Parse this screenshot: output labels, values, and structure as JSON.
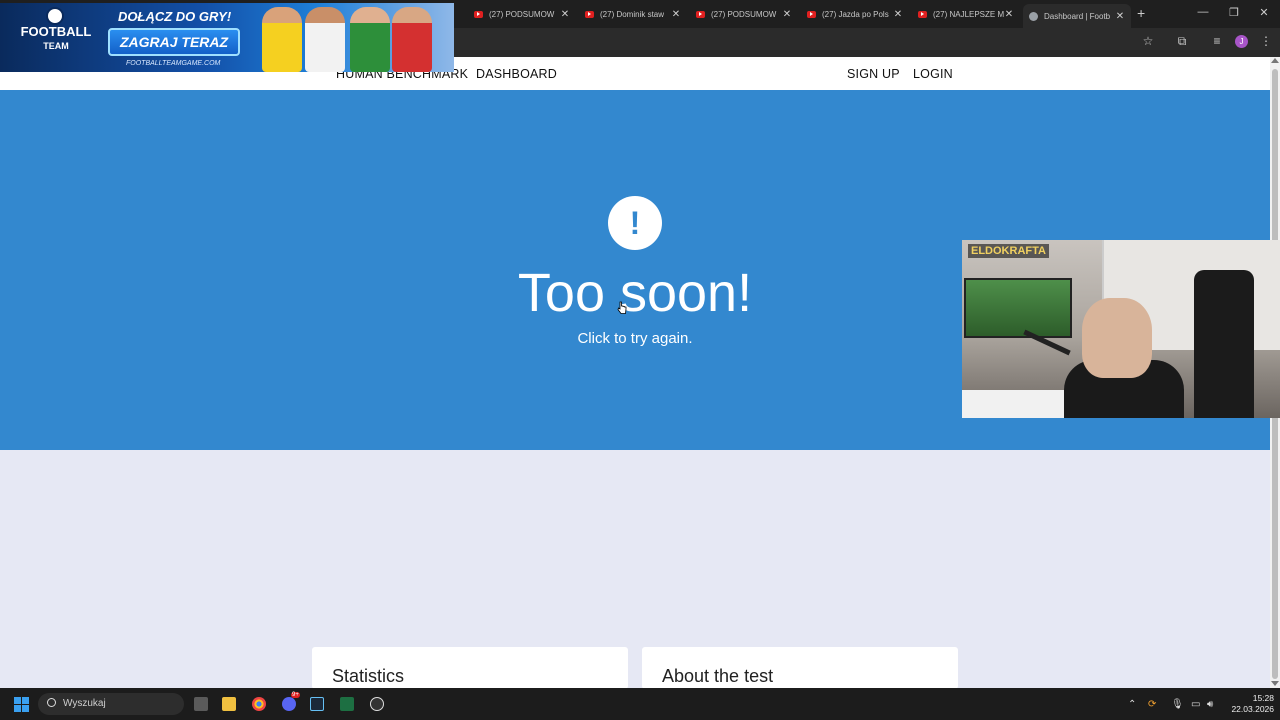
{
  "browser": {
    "tabs": [
      {
        "title": "(27) PODSUMOW",
        "icon": "youtube-icon"
      },
      {
        "title": "(27) Dominik staw",
        "icon": "youtube-icon"
      },
      {
        "title": "(27) PODSUMOW",
        "icon": "youtube-icon"
      },
      {
        "title": "(27) Jazda po Pols",
        "icon": "youtube-icon"
      },
      {
        "title": "(27) NAJLEPSZE M",
        "icon": "youtube-icon"
      },
      {
        "title": "Dashboard | Footb",
        "icon": "globe-icon",
        "active": true
      }
    ],
    "profile_initial": "J"
  },
  "ad": {
    "headline": "DOŁĄCZ DO GRY!",
    "cta": "ZAGRAJ TERAZ",
    "url": "FOOTBALLTEAMGAME.COM",
    "logo_line1": "FOOTBALL",
    "logo_line2": "TEAM"
  },
  "nav": {
    "home": "HUMAN BENCHMARK",
    "dashboard": "DASHBOARD",
    "signup": "SIGN UP",
    "login": "LOGIN"
  },
  "hero": {
    "icon_glyph": "!",
    "title": "Too soon!",
    "subtitle": "Click to try again.",
    "bg_color": "#3388cf"
  },
  "cards": {
    "statistics": "Statistics",
    "about": "About the test"
  },
  "webcam": {
    "logo": "ELDOKRAFTA"
  },
  "taskbar": {
    "search_placeholder": "Wyszukaj",
    "discord_badge": "9+",
    "time": "15:28",
    "date": "22.03.2026"
  }
}
